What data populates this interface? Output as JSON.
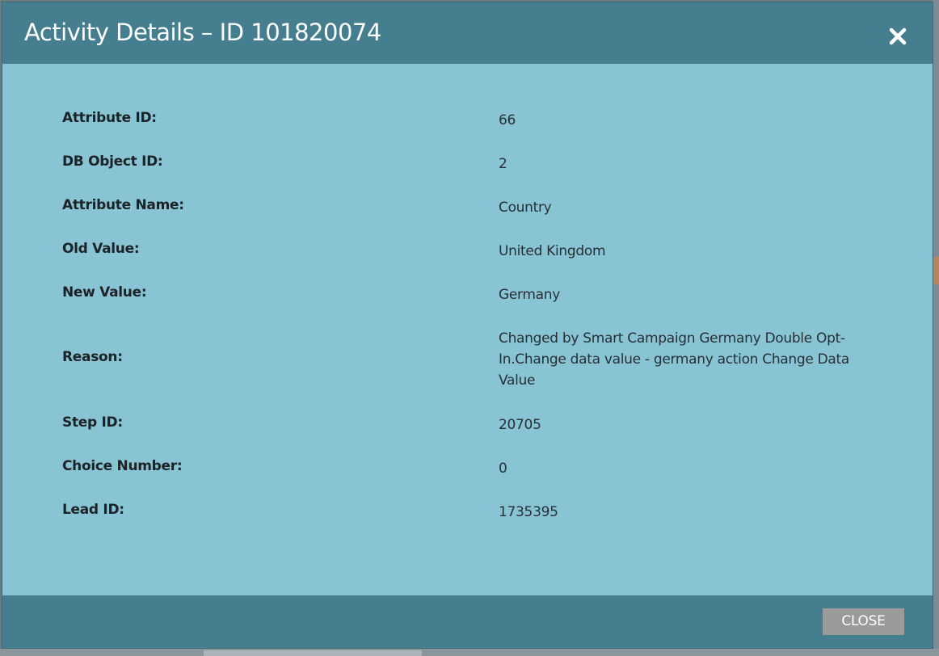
{
  "dialog": {
    "title": "Activity Details – ID 101820074",
    "close_icon": "close-x-icon",
    "close_button_label": "CLOSE"
  },
  "details": [
    {
      "label": "Attribute ID:",
      "value": "66"
    },
    {
      "label": "DB Object ID:",
      "value": "2"
    },
    {
      "label": "Attribute Name:",
      "value": "Country"
    },
    {
      "label": "Old Value:",
      "value": "United Kingdom"
    },
    {
      "label": "New Value:",
      "value": "Germany"
    },
    {
      "label": "Reason:",
      "value": "Changed by Smart Campaign Germany Double Opt-In.Change data value - germany action Change Data Value"
    },
    {
      "label": "Step ID:",
      "value": "20705"
    },
    {
      "label": "Choice Number:",
      "value": "0"
    },
    {
      "label": "Lead ID:",
      "value": "1735395"
    }
  ],
  "colors": {
    "header_bg": "#447e8f",
    "body_bg": "#89c4d4",
    "button_bg": "#9a9a9a"
  }
}
